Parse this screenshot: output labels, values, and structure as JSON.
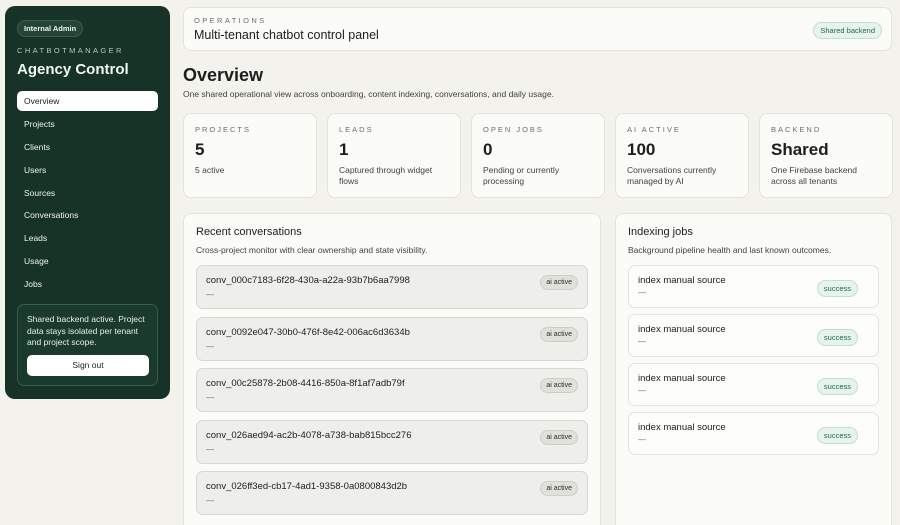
{
  "sidebar": {
    "badge": "Internal Admin",
    "eyebrow": "CHATBOTMANAGER",
    "title": "Agency Control",
    "items": [
      {
        "label": "Overview",
        "active": true
      },
      {
        "label": "Projects"
      },
      {
        "label": "Clients"
      },
      {
        "label": "Users"
      },
      {
        "label": "Sources"
      },
      {
        "label": "Conversations"
      },
      {
        "label": "Leads"
      },
      {
        "label": "Usage"
      },
      {
        "label": "Jobs"
      }
    ],
    "card_text": "Shared backend active. Project data stays isolated per tenant and project scope.",
    "signout_label": "Sign out"
  },
  "header": {
    "eyebrow": "OPERATIONS",
    "title": "Multi-tenant chatbot control panel",
    "badge": "Shared backend"
  },
  "overview": {
    "title": "Overview",
    "subtitle": "One shared operational view across onboarding, content indexing, conversations, and daily usage."
  },
  "stats": [
    {
      "label": "PROJECTS",
      "value": "5",
      "note": "5 active"
    },
    {
      "label": "LEADS",
      "value": "1",
      "note": "Captured through widget flows"
    },
    {
      "label": "OPEN JOBS",
      "value": "0",
      "note": "Pending or currently processing"
    },
    {
      "label": "AI ACTIVE",
      "value": "100",
      "note": "Conversations currently managed by AI"
    },
    {
      "label": "BACKEND",
      "value": "Shared",
      "note": "One Firebase backend across all tenants"
    }
  ],
  "conversations": {
    "title": "Recent conversations",
    "subtitle": "Cross-project monitor with clear ownership and state visibility.",
    "rows": [
      {
        "id": "conv_000c7183-6f28-430a-a22a-93b7b6aa7998",
        "detail": "—",
        "status": "ai active"
      },
      {
        "id": "conv_0092e047-30b0-476f-8e42-006ac6d3634b",
        "detail": "—",
        "status": "ai active"
      },
      {
        "id": "conv_00c25878-2b08-4416-850a-8f1af7adb79f",
        "detail": "—",
        "status": "ai active"
      },
      {
        "id": "conv_026aed94-ac2b-4078-a738-bab815bcc276",
        "detail": "—",
        "status": "ai active"
      },
      {
        "id": "conv_026ff3ed-cb17-4ad1-9358-0a0800843d2b",
        "detail": "—",
        "status": "ai active"
      }
    ]
  },
  "jobs": {
    "title": "Indexing jobs",
    "subtitle": "Background pipeline health and last known outcomes.",
    "rows": [
      {
        "title": "index manual source",
        "detail": "—",
        "status": "success"
      },
      {
        "title": "index manual source",
        "detail": "—",
        "status": "success"
      },
      {
        "title": "index manual source",
        "detail": "—",
        "status": "success"
      },
      {
        "title": "index manual source",
        "detail": "—",
        "status": "success"
      }
    ]
  }
}
